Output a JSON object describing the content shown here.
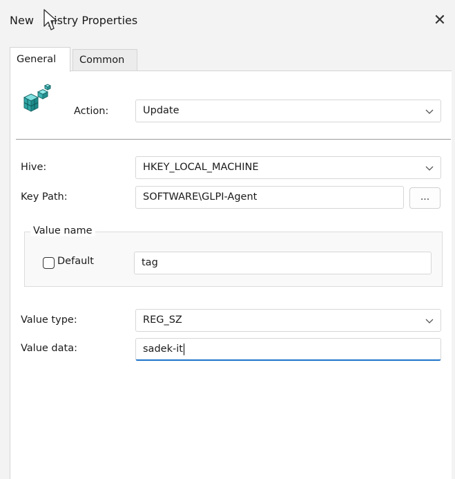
{
  "window": {
    "title": "New Registry Properties",
    "title_prefix": "New ",
    "title_suffix": "gistry Properties",
    "close_glyph": "✕"
  },
  "tabs": [
    {
      "label": "General",
      "active": true
    },
    {
      "label": "Common",
      "active": false
    }
  ],
  "general": {
    "action_label": "Action:",
    "action_value": "Update",
    "hive_label": "Hive:",
    "hive_value": "HKEY_LOCAL_MACHINE",
    "key_path_label": "Key Path:",
    "key_path_value": "SOFTWARE\\GLPI-Agent",
    "browse_label": "...",
    "value_name_group_label": "Value name",
    "default_checkbox_label": "Default",
    "default_checked": false,
    "value_name_value": "tag",
    "value_type_label": "Value type:",
    "value_type_value": "REG_SZ",
    "value_data_label": "Value data:",
    "value_data_value": "sadek-it"
  },
  "icons": {
    "registry": "registry-icon",
    "dropdown": "chevron-down-icon",
    "close": "close-icon",
    "cursor": "mouse-cursor-icon"
  },
  "colors": {
    "focus_accent": "#1a73c8",
    "dialog_bg": "#f3f3f3",
    "panel_bg": "#ffffff"
  }
}
